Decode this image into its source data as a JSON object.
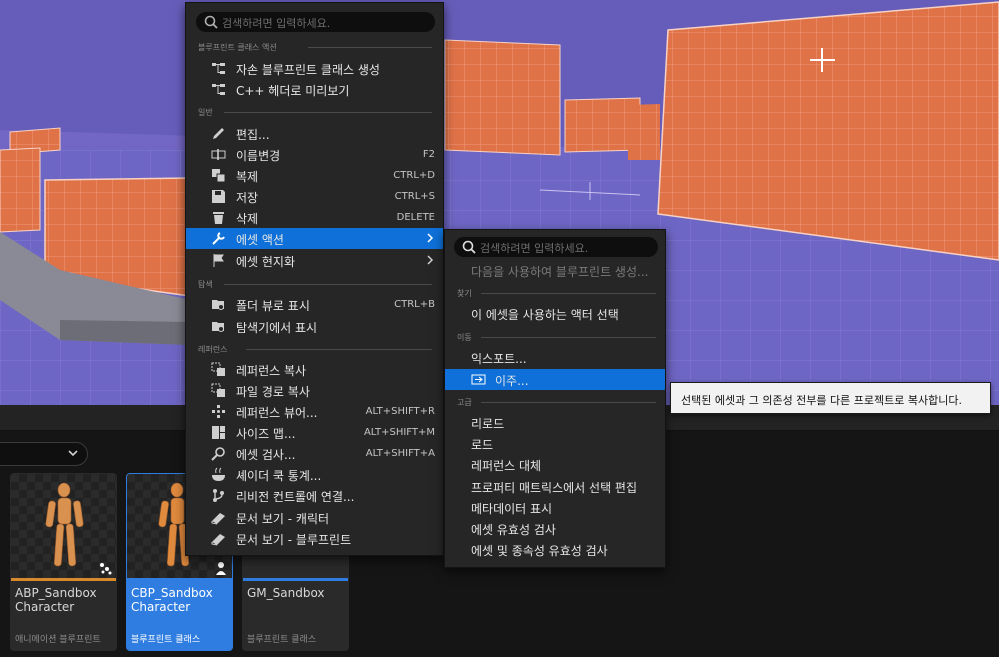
{
  "main_menu": {
    "search_placeholder": "검색하려면 입력하세요.",
    "sections": [
      {
        "header": "블루프린트 클래스 액션"
      },
      {
        "header": "일반"
      },
      {
        "header": "탐색"
      },
      {
        "header": "레퍼런스"
      }
    ],
    "items": [
      {
        "label": "자손 블루프린트 클래스 생성",
        "shortcut": "",
        "icon": "blueprint-hierarchy-icon"
      },
      {
        "label": "C++ 헤더로 미리보기",
        "shortcut": "",
        "icon": "blueprint-hierarchy-icon"
      },
      {
        "label": "편집...",
        "shortcut": "",
        "icon": "pencil-icon"
      },
      {
        "label": "이름변경",
        "shortcut": "F2",
        "icon": "rename-icon"
      },
      {
        "label": "복제",
        "shortcut": "CTRL+D",
        "icon": "duplicate-icon"
      },
      {
        "label": "저장",
        "shortcut": "CTRL+S",
        "icon": "save-icon"
      },
      {
        "label": "삭제",
        "shortcut": "DELETE",
        "icon": "trash-icon"
      },
      {
        "label": "에셋 액션",
        "shortcut": "",
        "icon": "wrench-icon",
        "highlighted": true,
        "submenu": true
      },
      {
        "label": "에셋 현지화",
        "shortcut": "",
        "icon": "flag-icon",
        "submenu": true
      },
      {
        "label": "폴더 뷰로 표시",
        "shortcut": "CTRL+B",
        "icon": "folder-search-icon"
      },
      {
        "label": "탐색기에서 표시",
        "shortcut": "",
        "icon": "folder-search-icon"
      },
      {
        "label": "레퍼런스 복사",
        "shortcut": "",
        "icon": "copy-reference-icon"
      },
      {
        "label": "파일 경로 복사",
        "shortcut": "",
        "icon": "copy-path-icon"
      },
      {
        "label": "레퍼런스 뷰어...",
        "shortcut": "ALT+SHIFT+R",
        "icon": "reference-viewer-icon"
      },
      {
        "label": "사이즈 맵...",
        "shortcut": "ALT+SHIFT+M",
        "icon": "size-map-icon"
      },
      {
        "label": "에셋 검사...",
        "shortcut": "ALT+SHIFT+A",
        "icon": "audit-icon"
      },
      {
        "label": "셰이더 쿡 통계...",
        "shortcut": "",
        "icon": "shader-cook-icon"
      },
      {
        "label": "리비전 컨트롤에 연결...",
        "shortcut": "",
        "icon": "source-control-icon"
      },
      {
        "label": "문서 보기 - 캐릭터",
        "shortcut": "",
        "icon": "docs-icon"
      },
      {
        "label": "문서 보기 - 블루프린트",
        "shortcut": "",
        "icon": "docs-icon"
      }
    ]
  },
  "sub_menu": {
    "search_placeholder": "검색하려면 입력하세요.",
    "disabled_item": "다음을 사용하여 블루프린트 생성...",
    "sections": [
      {
        "header": "찾기"
      },
      {
        "header": "이동"
      },
      {
        "header": "고급"
      }
    ],
    "items": [
      {
        "label": "이 에셋을 사용하는 액터 선택"
      },
      {
        "label": "익스포트..."
      },
      {
        "label": "이주...",
        "highlighted": true,
        "icon": "migrate-icon"
      },
      {
        "label": "리로드"
      },
      {
        "label": "로드"
      },
      {
        "label": "레퍼런스 대체"
      },
      {
        "label": "프로퍼티 매트릭스에서 선택 편집"
      },
      {
        "label": "메타데이터 표시"
      },
      {
        "label": "에셋 유효성 검사"
      },
      {
        "label": "에셋 및 종속성 유효성 검사"
      }
    ]
  },
  "tooltip": {
    "text": "선택된 에셋과 그 의존성 전부를 다른 프로젝트로 복사합니다."
  },
  "assets": [
    {
      "name": "ABP_Sandbox\nCharacter",
      "type": "애니메이션 블루프린트",
      "bar_color": "#d88a2a",
      "selected": false,
      "badge": "anim-blueprint-icon"
    },
    {
      "name": "CBP_Sandbox\nCharacter",
      "type": "블루프린트 클래스",
      "bar_color": "#2f7de0",
      "selected": true,
      "badge": "character-icon"
    },
    {
      "name": "GM_Sandbox",
      "type": "블루프린트 클래스",
      "bar_color": "#2f7de0",
      "selected": false,
      "badge": ""
    }
  ],
  "colors": {
    "highlight": "#0e70d8",
    "menu_bg": "#262626",
    "sky": "#6a60b8",
    "wall": "#e0714a"
  }
}
